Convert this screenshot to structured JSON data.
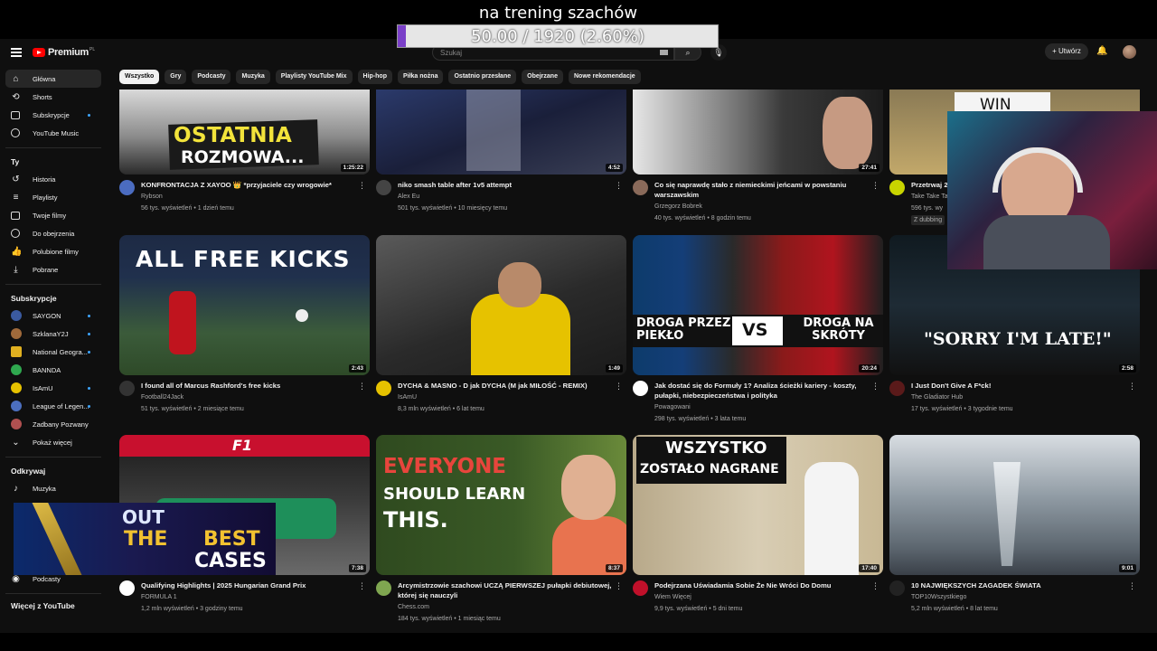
{
  "overlay": {
    "title": "na trening szachów",
    "goal_text": "50.00 / 1920 (2.60%)",
    "goal_progress_percent": 2.6,
    "goal_color": "#7a3fc8"
  },
  "topbar": {
    "logo_text": "Premium",
    "logo_region": "PL",
    "search_placeholder": "Szukaj",
    "create_label": "Utwórz",
    "menu_icon": "hamburger-icon",
    "search_icon": "magnifier-icon",
    "mic_icon": "microphone-icon",
    "bell_icon": "bell-icon"
  },
  "sidebar": {
    "main": [
      {
        "label": "Główna",
        "icon": "home-icon",
        "active": true
      },
      {
        "label": "Shorts",
        "icon": "shorts-icon"
      },
      {
        "label": "Subskrypcje",
        "icon": "subscriptions-icon",
        "dot": true
      },
      {
        "label": "YouTube Music",
        "icon": "music-circle-icon"
      }
    ],
    "you_header": "Ty",
    "you": [
      {
        "label": "Historia",
        "icon": "history-icon"
      },
      {
        "label": "Playlisty",
        "icon": "playlist-icon"
      },
      {
        "label": "Twoje filmy",
        "icon": "your-videos-icon"
      },
      {
        "label": "Do obejrzenia",
        "icon": "watch-later-icon"
      },
      {
        "label": "Polubione filmy",
        "icon": "like-icon"
      },
      {
        "label": "Pobrane",
        "icon": "download-icon"
      }
    ],
    "subs_header": "Subskrypcje",
    "subs": [
      {
        "label": "SAYGON",
        "color": "#3b5aa0"
      },
      {
        "label": "SzklanaY2J",
        "color": "#a06a3b"
      },
      {
        "label": "National Geogra...",
        "color": "#e0b020"
      },
      {
        "label": "BANNDA",
        "color": "#2fa84f"
      },
      {
        "label": "IsAmU",
        "color": "#e6c200"
      },
      {
        "label": "League of Legen...",
        "color": "#4c6fbf"
      },
      {
        "label": "Zadbany Pozwany",
        "color": "#b05050"
      }
    ],
    "show_more": "Pokaż więcej",
    "explore_header": "Odkrywaj",
    "explore": [
      {
        "label": "Muzyka",
        "icon": "music-note-icon"
      },
      {
        "label": "Podcasty",
        "icon": "podcast-icon"
      }
    ],
    "more_header": "Więcej z YouTube"
  },
  "chips": [
    "Wszystko",
    "Gry",
    "Podcasty",
    "Muzyka",
    "Playlisty YouTube Mix",
    "Hip-hop",
    "Piłka nożna",
    "Ostatnio przesłane",
    "Obejrzane",
    "Nowe rekomendacje"
  ],
  "videos": [
    {
      "title": "KONFRONTACJA Z XAYOO 👑 *przyjaciele czy wrogowie*",
      "channel": "Rybson",
      "stats": "56 tys. wyświetleń • 1 dzień temu",
      "duration": "1:25:22",
      "thumb_text": [
        "OSTATNIA",
        "ROZMOWA..."
      ],
      "av": "#4b6cc0"
    },
    {
      "title": "niko smash table after 1v5 attempt",
      "channel": "Alex Eu",
      "stats": "501 tys. wyświetleń • 10 miesięcy temu",
      "duration": "4:52",
      "av": "#444"
    },
    {
      "title": "Co się naprawdę stało z niemieckimi jeńcami w powstaniu warszawskim",
      "channel": "Grzegorz Bobrek",
      "stats": "40 tys. wyświetleń • 8 godzin temu",
      "duration": "27:41",
      "av": "#8a6a5a"
    },
    {
      "title": "Przetrwaj 2",
      "channel": "Take Take Ta",
      "stats": "596 tys. wy",
      "badge": "Z dubbing",
      "thumb_text": [
        "WIN"
      ],
      "av": "#c8d400"
    },
    {
      "title": "I found all of Marcus Rashford's free kicks",
      "channel": "Football24Jack",
      "stats": "51 tys. wyświetleń • 2 miesiące temu",
      "duration": "2:43",
      "thumb_text": [
        "ALL FREE KICKS"
      ],
      "av": "#333"
    },
    {
      "title": "DYCHA & MASNO - D jak DYCHA (M jak MIŁOŚĆ - REMIX)",
      "channel": "IsAmU",
      "stats": "8,3 mln wyświetleń • 6 lat temu",
      "duration": "1:49",
      "av": "#e6c200"
    },
    {
      "title": "Jak dostać się do Formuły 1? Analiza ścieżki kariery - koszty, pułapki, niebezpieczeństwa i polityka",
      "channel": "Powagowani",
      "stats": "298 tys. wyświetleń • 3 lata temu",
      "duration": "20:24",
      "thumb_text": [
        "DROGA PRZEZ PIEKŁO",
        "VS",
        "DROGA NA SKRÓTY"
      ],
      "av": "#fff"
    },
    {
      "title": "I Just Don't Give A F*ck!",
      "channel": "The Gladiator Hub",
      "stats": "17 tys. wyświetleń • 3 tygodnie temu",
      "duration": "2:58",
      "thumb_text": [
        "\"SORRY I'M LATE!\""
      ],
      "av": "#5a1a1a"
    },
    {
      "title": "Qualifying Highlights | 2025 Hungarian Grand Prix",
      "channel": "FORMULA 1",
      "stats": "1,2 mln wyświetleń • 3 godziny temu",
      "duration": "7:38",
      "thumb_text": [
        "F1"
      ],
      "av": "#fff"
    },
    {
      "title": "Arcymistrzowie szachowi UCZĄ PIERWSZEJ pułapki debiutowej, której się nauczyli",
      "channel": "Chess.com",
      "stats": "184 tys. wyświetleń • 1 miesiąc temu",
      "duration": "8:37",
      "thumb_text": [
        "EVERYONE",
        "SHOULD LEARN",
        "THIS."
      ],
      "av": "#7fa650"
    },
    {
      "title": "Podejrzana Uświadamia Sobie Że Nie Wróci Do Domu",
      "channel": "Wiem Więcej",
      "stats": "9,9 tys. wyświetleń • 5 dni temu",
      "duration": "17:40",
      "thumb_text": [
        "WSZYSTKO",
        "ZOSTAŁO NAGRANE"
      ],
      "av": "#c0102a"
    },
    {
      "title": "10 NAJWIĘKSZYCH ZAGADEK ŚWIATA",
      "channel": "TOP10Wszystkiego",
      "stats": "5,2 mln wyświetleń • 8 lat temu",
      "duration": "9:01",
      "av": "#222"
    }
  ],
  "case_ad": {
    "lines": [
      "OUT",
      "THE",
      "BEST",
      "CASES"
    ]
  }
}
